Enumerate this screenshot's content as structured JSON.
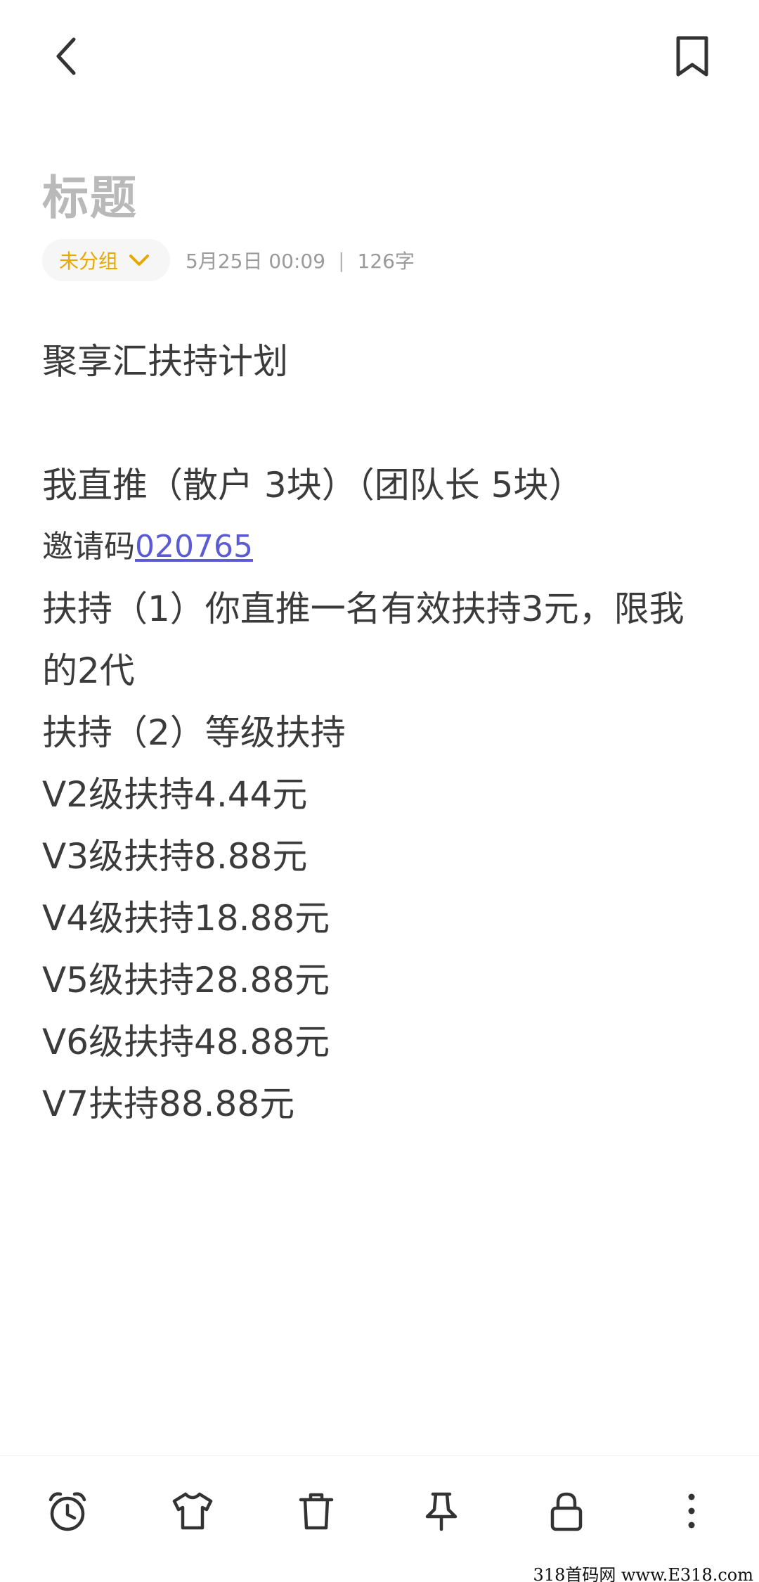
{
  "header": {
    "back_icon": "back-chevron-icon",
    "bookmark_icon": "bookmark-icon"
  },
  "note": {
    "title_placeholder": "标题",
    "group_label": "未分组",
    "date": "5月25日 00:09",
    "separator": "|",
    "word_count": "126字",
    "lines": {
      "l1": "聚享汇扶持计划",
      "l3": "我直推（散户 3块）（团队长 5块）",
      "invite_prefix": "邀请码",
      "invite_code": "020765",
      "l5": "扶持（1）你直推一名有效扶持3元，限我的2代",
      "l6": "扶持（2）等级扶持",
      "l7": "V2级扶持4.44元",
      "l8": "V3级扶持8.88元",
      "l9": "V4级扶持18.88元",
      "l10": "V5级扶持28.88元",
      "l11": "V6级扶持48.88元",
      "l12": "V7扶持88.88元"
    }
  },
  "toolbar": {
    "icons": [
      "alarm-clock-icon",
      "shirt-icon",
      "trash-icon",
      "pin-icon",
      "lock-icon",
      "more-icon"
    ]
  },
  "colors": {
    "accent": "#e7a900",
    "link": "#5b5bd6",
    "text": "#3b3b3b",
    "muted": "#9a9a9a"
  },
  "watermark": "318首码网 www.E318.com"
}
